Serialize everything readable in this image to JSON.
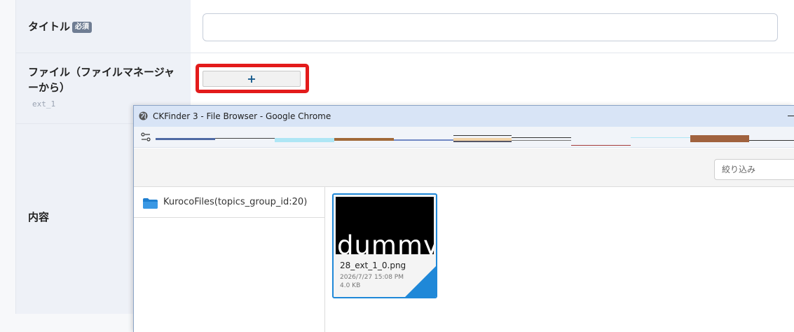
{
  "form": {
    "title_label": "タイトル",
    "required_badge": "必須",
    "title_value": "",
    "file_label_line1": "ファイル（ファイルマネージャ",
    "file_label_line2": "ーから）",
    "file_key": "ext_1",
    "add_button_label": "+",
    "content_label": "内容"
  },
  "popup": {
    "window_title": "CKFinder 3 - File Browser - Google Chrome",
    "filter_placeholder": "絞り込み",
    "folder": {
      "name": "KurocoFiles(topics_group_id:20)",
      "icon": "folder-icon"
    },
    "files": [
      {
        "thumbnail_text": "dummy",
        "name": "28_ext_1_0.png",
        "date": "2026/7/27 15:08 PM",
        "size": "4.0 KB",
        "selected": true
      }
    ]
  },
  "colors": {
    "accent": "#1f88d8",
    "highlight": "#e31b1b",
    "label_bg": "#eef1f7",
    "titlebar": "#d8e4f6"
  }
}
